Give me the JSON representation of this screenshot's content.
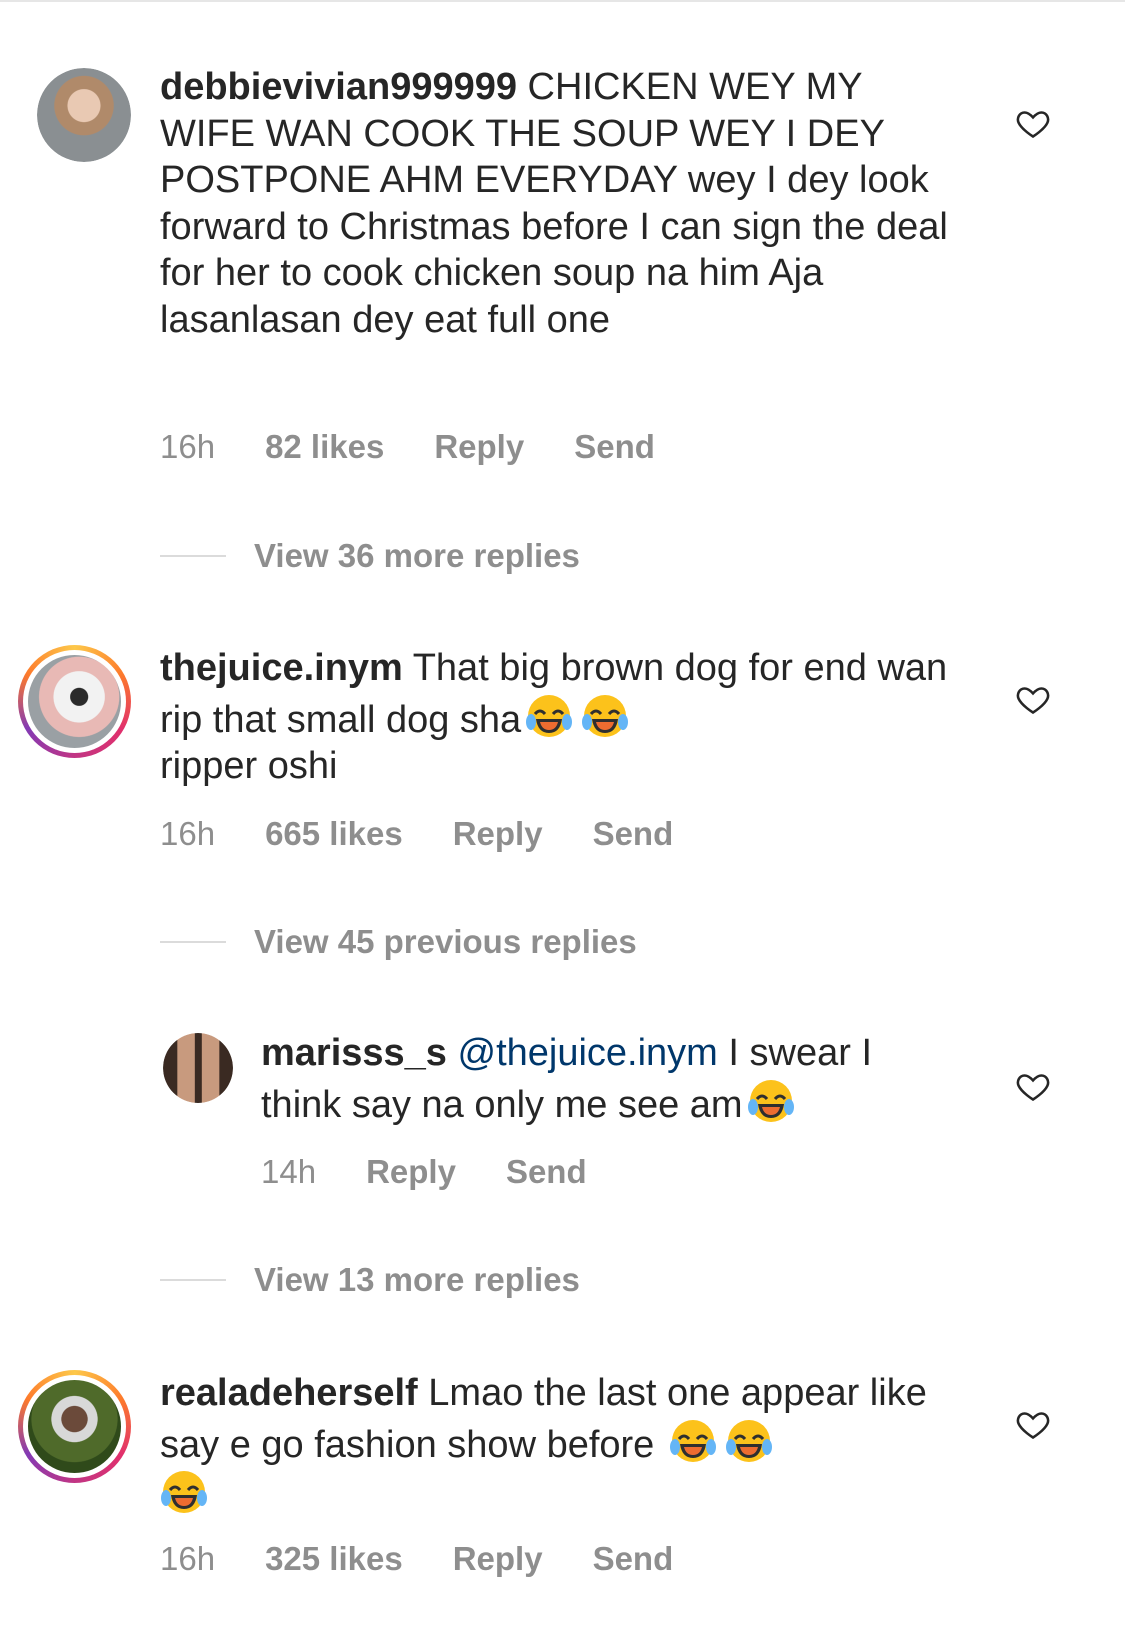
{
  "comments": [
    {
      "username": "debbievivian999999",
      "text": " CHICKEN WEY MY WIFE WAN COOK THE SOUP WEY I DEY POSTPONE AHM EVERYDAY  wey I dey look forward to Christmas before I can sign the deal for her to cook chicken soup na him Aja lasanlasan dey eat full one",
      "time": "16h",
      "likes": "82 likes",
      "reply": "Reply",
      "send": "Send",
      "view_replies": "View 36 more replies"
    },
    {
      "username": "thejuice.inym",
      "text": " That big brown dog for end wan rip that small dog sha",
      "text_after": "ripper oshi",
      "time": "16h",
      "likes": "665 likes",
      "reply": "Reply",
      "send": "Send",
      "view_replies": "View 45 previous replies"
    },
    {
      "username": "marisss_s",
      "mention": "@thejuice.inym",
      "text": " I swear I think say na only me see am",
      "time": "14h",
      "reply": "Reply",
      "send": "Send",
      "view_replies": "View 13 more replies"
    },
    {
      "username": "realadeherself",
      "text": " Lmao the last one appear like say e go fashion show before",
      "time": "16h",
      "likes": "325 likes",
      "reply": "Reply",
      "send": "Send"
    }
  ],
  "icons": {
    "like": "heart-outline-icon",
    "emoji": "face-with-tears-of-joy-emoji"
  },
  "colors": {
    "text": "#262626",
    "secondary": "#8e8e8e",
    "mention": "#00376b"
  }
}
